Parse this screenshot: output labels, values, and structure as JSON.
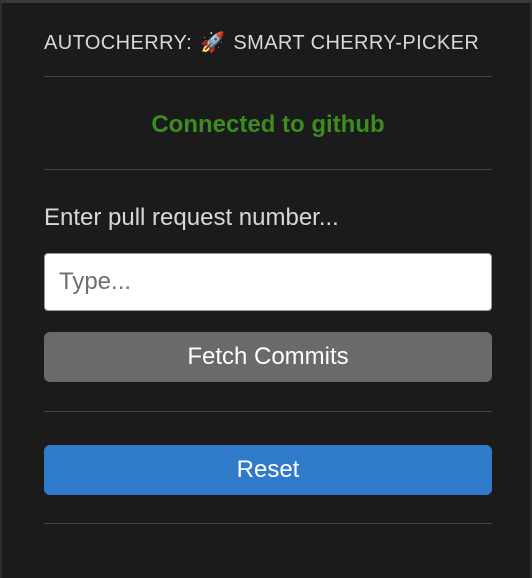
{
  "header": {
    "title_prefix": "AUTOCHERRY:",
    "rocket": "🚀",
    "title_suffix": "SMART CHERRY-PICKER"
  },
  "status": {
    "text": "Connected to github",
    "color": "#3c8c1f"
  },
  "pr_form": {
    "prompt": "Enter pull request number...",
    "input_value": "",
    "input_placeholder": "Type...",
    "fetch_label": "Fetch Commits"
  },
  "reset_label": "Reset",
  "colors": {
    "background": "#1b1b1b",
    "fetch_button": "#6a6a6a",
    "reset_button": "#2f7bc9"
  }
}
